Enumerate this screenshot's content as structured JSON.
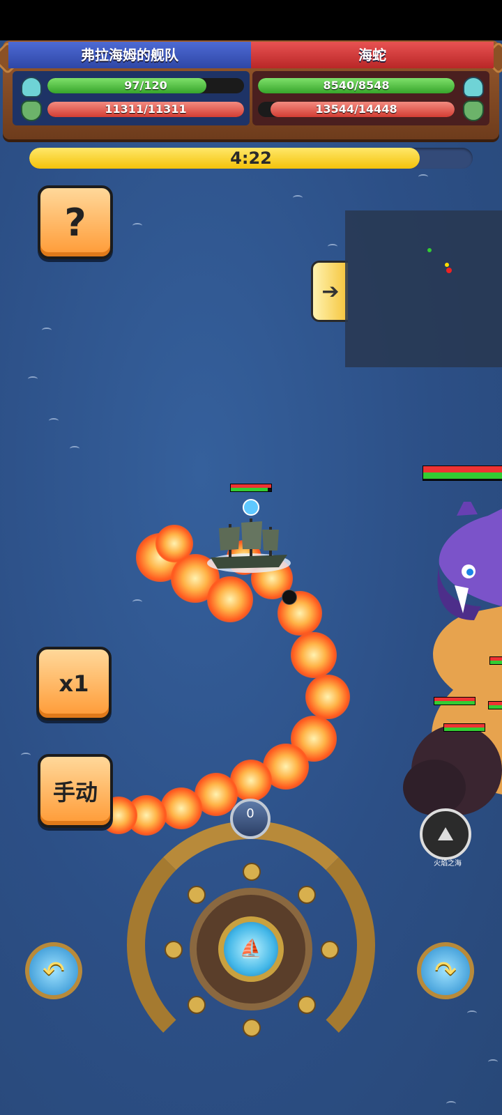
{
  "fleet": {
    "player_name": "弗拉海姆的舰队",
    "enemy_name": "海蛇",
    "player_crew": "97/120",
    "player_crew_ratio": 0.808,
    "player_hp": "11311/11311",
    "player_hp_ratio": 1.0,
    "enemy_crew": "8540/8548",
    "enemy_crew_ratio": 0.999,
    "enemy_hp": "13544/14448",
    "enemy_hp_ratio": 0.937
  },
  "timer": {
    "text": "4:22",
    "ratio": 0.88
  },
  "buttons": {
    "help_label": "?",
    "speed_label": "x1",
    "mode_label": "手动"
  },
  "helm": {
    "counter": "0"
  },
  "zone": {
    "label": "火焰之海",
    "icon": "volcano-icon"
  },
  "icons": {
    "crew": "sailor-icon",
    "ship": "ship-icon",
    "minimap_toggle": "arrow-right-icon",
    "rotate_left": "rotate-left-icon",
    "rotate_right": "rotate-right-icon",
    "compass": "compass-icon"
  },
  "colors": {
    "player_team": "#2f47a6",
    "enemy_team": "#b92727",
    "hp_green": "#37a52b",
    "hp_red": "#d33d33",
    "timer_yellow": "#f4c20a",
    "button_orange": "#ff9a35"
  }
}
